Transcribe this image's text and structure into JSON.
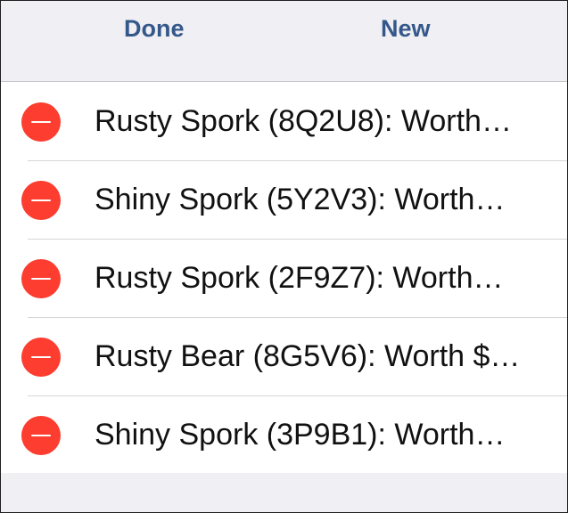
{
  "toolbar": {
    "done_label": "Done",
    "new_label": "New"
  },
  "items": [
    {
      "label": "Rusty Spork (8Q2U8): Worth…"
    },
    {
      "label": "Shiny Spork (5Y2V3): Worth…"
    },
    {
      "label": "Rusty Spork (2F9Z7): Worth…"
    },
    {
      "label": "Rusty Bear (8G5V6): Worth $…"
    },
    {
      "label": "Shiny Spork (3P9B1): Worth…"
    }
  ],
  "icons": {
    "delete": "minus-circle-icon"
  },
  "colors": {
    "accent": "#35588a",
    "delete": "#fc3d2f",
    "background": "#efeff4"
  }
}
